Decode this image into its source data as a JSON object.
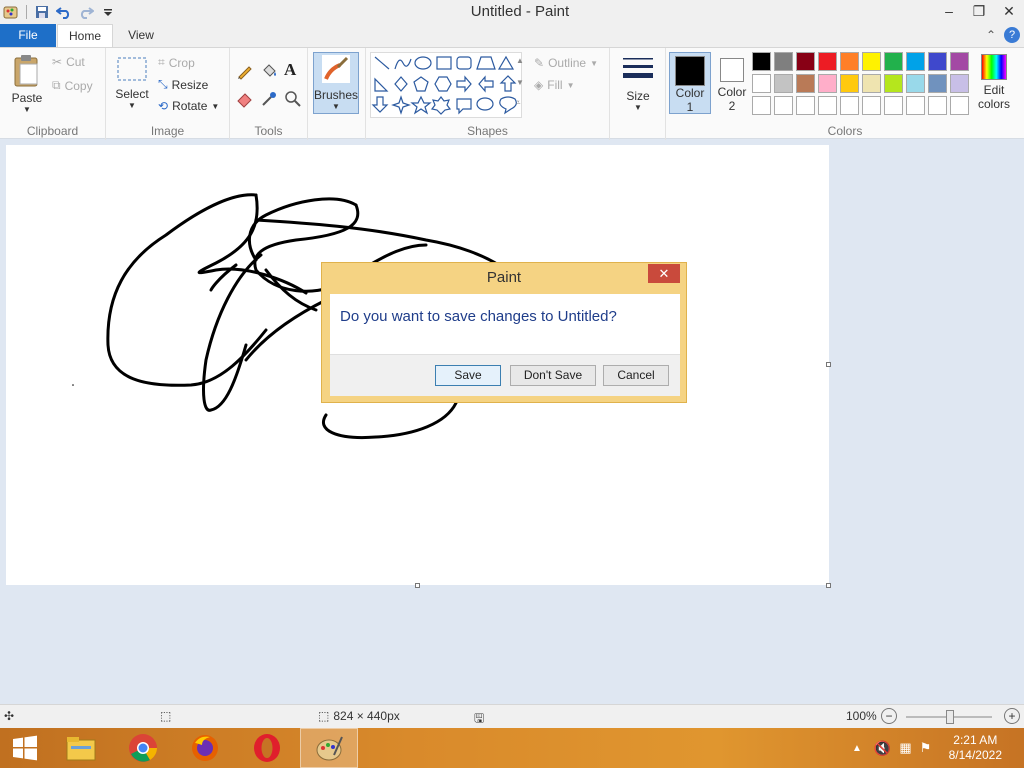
{
  "window": {
    "title": "Untitled - Paint",
    "controls": {
      "minimize": "–",
      "maximize": "❐",
      "close": "✕"
    }
  },
  "quick_access": {
    "icons": [
      "paint-app-icon",
      "save-icon",
      "undo-icon",
      "redo-icon",
      "customize-qat-icon"
    ]
  },
  "tabs": {
    "file": "File",
    "home": "Home",
    "view": "View"
  },
  "ribbon": {
    "clipboard": {
      "paste": "Paste",
      "cut": "Cut",
      "copy": "Copy",
      "group": "Clipboard"
    },
    "image": {
      "select": "Select",
      "crop": "Crop",
      "resize": "Resize",
      "rotate": "Rotate",
      "group": "Image"
    },
    "tools": {
      "group": "Tools"
    },
    "brushes": {
      "label": "Brushes"
    },
    "shapes": {
      "outline": "Outline",
      "fill": "Fill",
      "group": "Shapes"
    },
    "size": {
      "label": "Size"
    },
    "color1": {
      "label_line1": "Color",
      "label_line2": "1",
      "value": "#000000"
    },
    "color2": {
      "label_line1": "Color",
      "label_line2": "2",
      "value": "#ffffff"
    },
    "edit_colors": {
      "label_line1": "Edit",
      "label_line2": "colors"
    },
    "colors_group": "Colors",
    "palette": [
      "#000000",
      "#7f7f7f",
      "#880015",
      "#ed1c24",
      "#ff7f27",
      "#fff200",
      "#22b14c",
      "#00a2e8",
      "#3f48cc",
      "#a349a4",
      "#ffffff",
      "#c3c3c3",
      "#b97a57",
      "#ffaec9",
      "#ffc90e",
      "#efe4b0",
      "#b5e61d",
      "#99d9ea",
      "#7092be",
      "#c8bfe7",
      "#ffffff",
      "#ffffff",
      "#ffffff",
      "#ffffff",
      "#ffffff",
      "#ffffff",
      "#ffffff",
      "#ffffff",
      "#ffffff",
      "#ffffff"
    ]
  },
  "dialog": {
    "title": "Paint",
    "close": "✕",
    "message": "Do you want to save changes to Untitled?",
    "buttons": {
      "save": "Save",
      "dont_save": "Don't Save",
      "cancel": "Cancel"
    }
  },
  "statusbar": {
    "canvas_size": "824 × 440px",
    "zoom": "100%",
    "zoom_level": 1.0
  },
  "taskbar": {
    "apps": [
      "file-explorer-icon",
      "chrome-icon",
      "firefox-icon",
      "opera-icon",
      "paint-icon"
    ],
    "active_app": "paint-icon",
    "time": "2:21 AM",
    "date": "8/14/2022"
  },
  "colors": {
    "accent": "#1e6fc8",
    "dialog_frame": "#f5d383",
    "taskbar": "#d98a2b"
  }
}
